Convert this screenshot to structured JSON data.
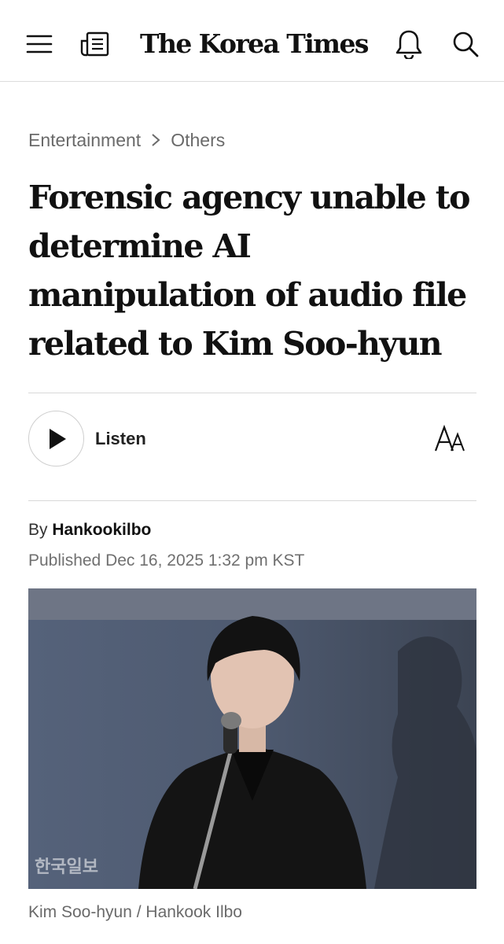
{
  "header": {
    "logo": "The Korea Times",
    "menu_icon": "menu-icon",
    "newspaper_icon": "newspaper-icon",
    "notification_icon": "bell-icon",
    "search_icon": "search-icon"
  },
  "breadcrumb": {
    "section": "Entertainment",
    "subsection": "Others",
    "separator_icon": "chevron-right-icon"
  },
  "article": {
    "headline_lines": [
      "Forensic agency unable to",
      "determine AI",
      "manipulation of audio file",
      "related to Kim Soo-hyun"
    ],
    "listen_label": "Listen",
    "byline_prefix": "By",
    "author": "Hankookilbo",
    "published": "Published Dec 16, 2025 1:32 pm KST",
    "photo_watermark": "한국일보",
    "caption": "Kim Soo-hyun / Hankook Ilbo"
  },
  "colors": {
    "text": "#111111",
    "muted": "#6a6a6a",
    "divider": "#d9d9d9"
  }
}
